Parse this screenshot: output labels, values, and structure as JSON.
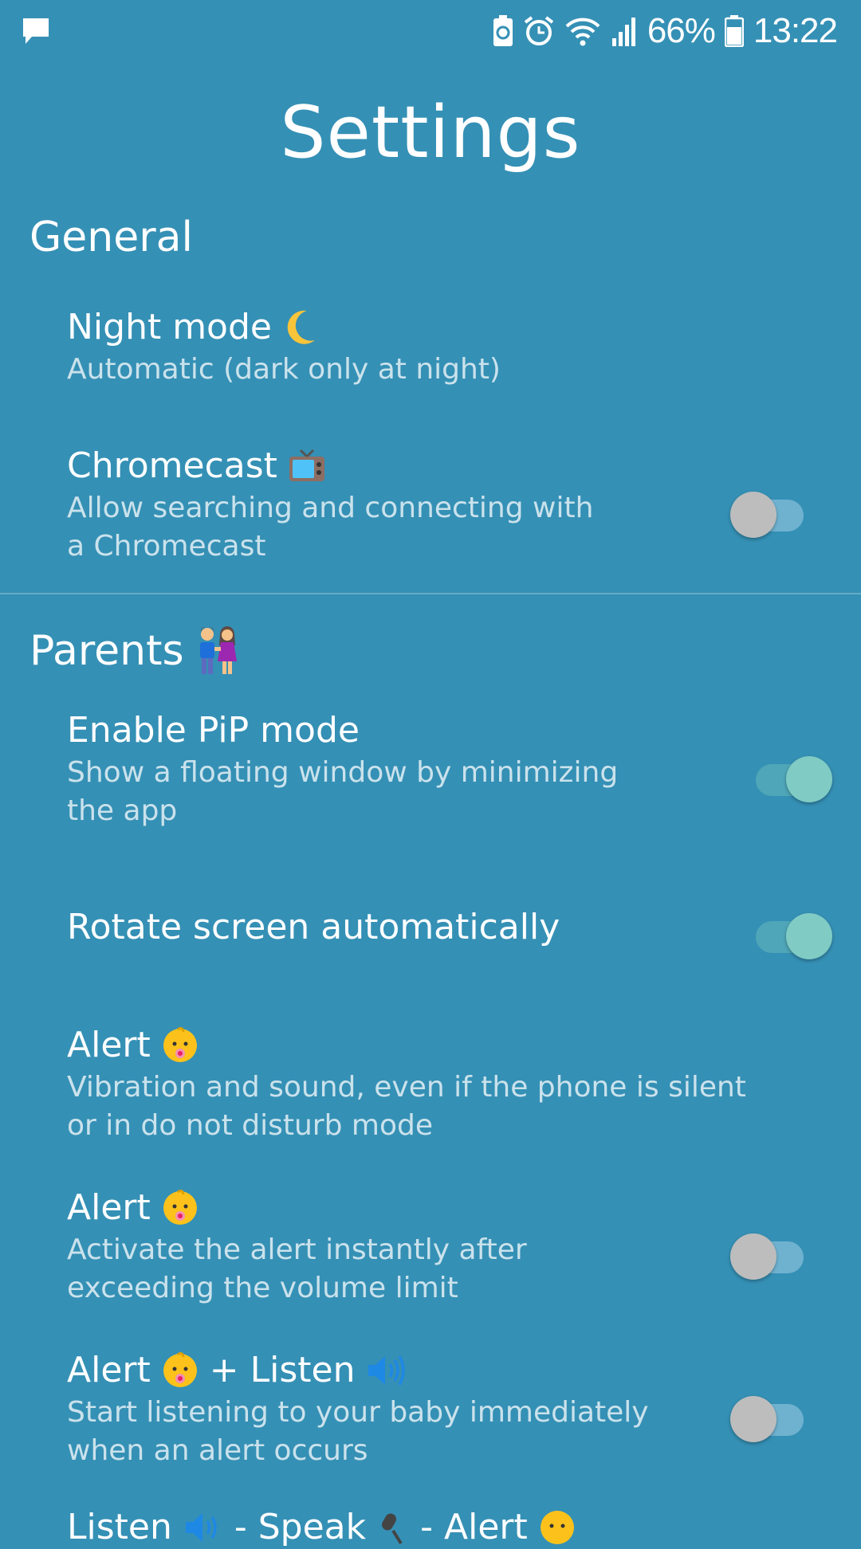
{
  "status_bar": {
    "battery_percent": "66%",
    "time": "13:22"
  },
  "title": "Settings",
  "sections": {
    "general": {
      "heading": "General",
      "night_mode": {
        "title": "Night mode",
        "summary": "Automatic (dark only at night)"
      },
      "chromecast": {
        "title": "Chromecast",
        "summary": "Allow searching and connecting with\na Chromecast",
        "enabled": false
      }
    },
    "parents": {
      "heading": "Parents",
      "pip_mode": {
        "title": "Enable PiP mode",
        "summary": "Show a floating window by minimizing\nthe app",
        "enabled": true
      },
      "rotate_screen": {
        "title": "Rotate screen automatically",
        "enabled": true
      },
      "alert_vibration": {
        "title": "Alert",
        "summary": "Vibration and sound, even if the phone is silent\nor in do not disturb mode"
      },
      "alert_instant": {
        "title": "Alert",
        "summary": "Activate the alert instantly after\nexceeding the volume limit",
        "enabled": false
      },
      "alert_listen": {
        "title_part1": "Alert",
        "title_part2": "+ Listen",
        "summary": "Start listening to your baby immediately\nwhen an alert occurs",
        "enabled": false
      },
      "partial_next": {
        "part1": "Listen",
        "part2": "- Speak",
        "part3": "- Alert"
      }
    }
  },
  "icons": {
    "status_left": "message-icon",
    "night_mode": "crescent-moon-icon",
    "chromecast": "television-icon",
    "parents": "couple-icon",
    "alert": "baby-icon",
    "listen": "speaker-icon",
    "speak": "microphone-icon"
  },
  "colors": {
    "background": "#3590b5",
    "switch_on_thumb": "#80cbc4",
    "switch_off_thumb": "#bdbdbd"
  }
}
